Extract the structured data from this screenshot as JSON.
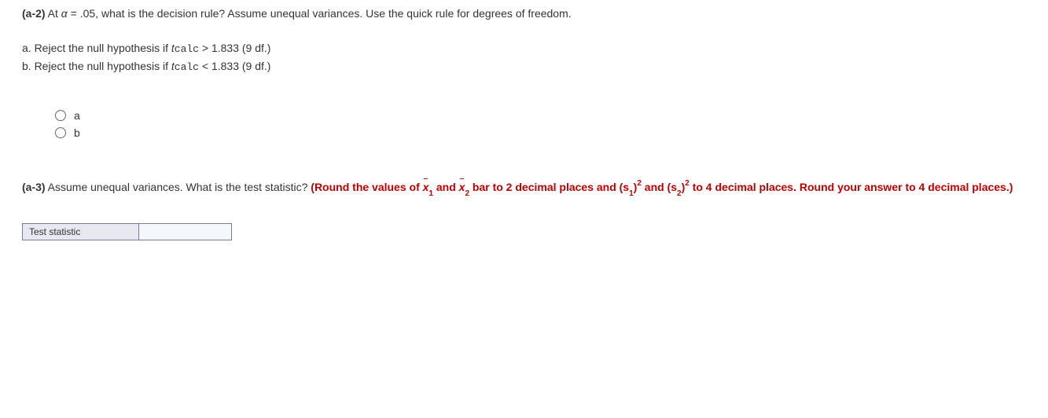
{
  "q_a2": {
    "label": "(a-2)",
    "text_before_alpha": " At ",
    "alpha": "α",
    "text_after_alpha": " = .05, what is the decision rule? Assume unequal variances. Use the quick rule for degrees of freedom.",
    "option_a_prefix": "a. Reject the null hypothesis if ",
    "tcalc_t": "t",
    "tcalc_sub": "calc",
    "option_a_suffix": " > 1.833 (9 df.)",
    "option_b_prefix": "b. Reject the null hypothesis if ",
    "option_b_suffix": " < 1.833 (9 df.)",
    "radio_a": "a",
    "radio_b": "b"
  },
  "q_a3": {
    "label": "(a-3)",
    "text1": " Assume unequal variances. What is the test statistic? ",
    "red1": "(Round the values of ",
    "x": "x",
    "one": "1",
    "red2": " and ",
    "two": "2",
    "red3": " bar to 2 decimal places and (s",
    "red_paren": ")",
    "red_sq": "2",
    "red4": " and (s",
    "red5": " to 4 decimal places. Round your answer to 4 decimal places.)"
  },
  "table": {
    "label": "Test statistic",
    "placeholder": ""
  }
}
